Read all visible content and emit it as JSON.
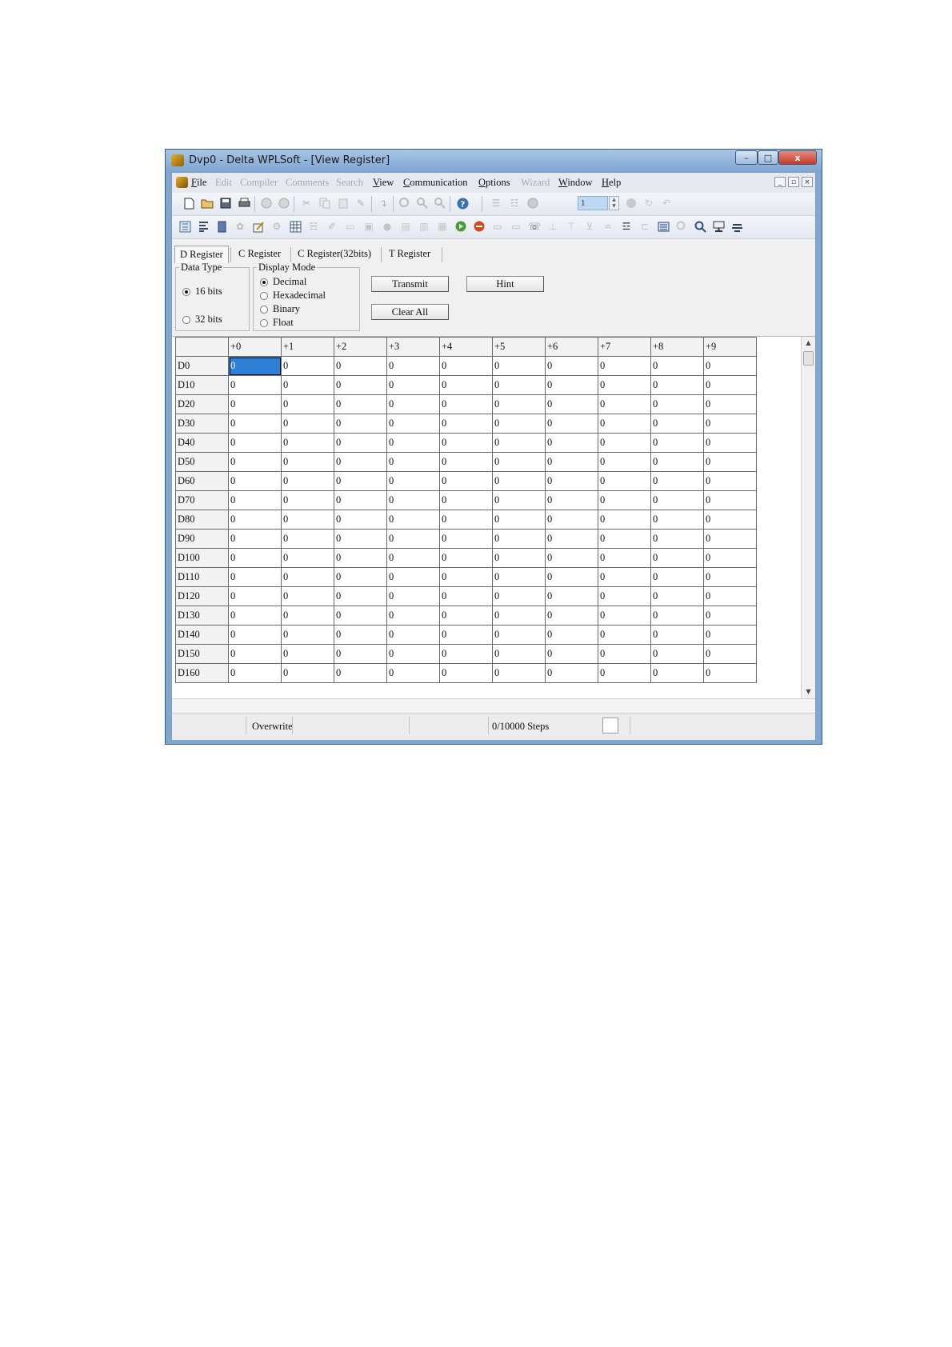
{
  "window": {
    "title": "Dvp0 - Delta WPLSoft - [View Register]",
    "min_glyph": "–",
    "max_glyph": "□",
    "close_glyph": "x"
  },
  "menu": [
    {
      "label": "File",
      "enabled": true
    },
    {
      "label": "Edit",
      "enabled": false
    },
    {
      "label": "Compiler",
      "enabled": false
    },
    {
      "label": "Comments",
      "enabled": false
    },
    {
      "label": "Search",
      "enabled": false
    },
    {
      "label": "View",
      "enabled": true
    },
    {
      "label": "Communication",
      "enabled": true
    },
    {
      "label": "Options",
      "enabled": true
    },
    {
      "label": "Wizard",
      "enabled": false
    },
    {
      "label": "Window",
      "enabled": true
    },
    {
      "label": "Help",
      "enabled": true
    }
  ],
  "mdi": {
    "min": "_",
    "restore": "▫",
    "close": "×"
  },
  "toolbar": {
    "step_value": "1"
  },
  "tabs": [
    "D Register",
    "C Register",
    "C Register(32bits)",
    "T Register"
  ],
  "data_type": {
    "legend": "Data Type",
    "options": [
      "16 bits",
      "32 bits"
    ],
    "selected": "16 bits"
  },
  "display_mode": {
    "legend": "Display Mode",
    "options": [
      "Decimal",
      "Hexadecimal",
      "Binary",
      "Float"
    ],
    "selected": "Decimal"
  },
  "buttons": {
    "transmit": "Transmit",
    "hint": "Hint",
    "clear_all": "Clear All"
  },
  "grid": {
    "columns": [
      "+0",
      "+1",
      "+2",
      "+3",
      "+4",
      "+5",
      "+6",
      "+7",
      "+8",
      "+9"
    ],
    "rows": [
      {
        "label": "D0",
        "values": [
          "0",
          "0",
          "0",
          "0",
          "0",
          "0",
          "0",
          "0",
          "0",
          "0"
        ]
      },
      {
        "label": "D10",
        "values": [
          "0",
          "0",
          "0",
          "0",
          "0",
          "0",
          "0",
          "0",
          "0",
          "0"
        ]
      },
      {
        "label": "D20",
        "values": [
          "0",
          "0",
          "0",
          "0",
          "0",
          "0",
          "0",
          "0",
          "0",
          "0"
        ]
      },
      {
        "label": "D30",
        "values": [
          "0",
          "0",
          "0",
          "0",
          "0",
          "0",
          "0",
          "0",
          "0",
          "0"
        ]
      },
      {
        "label": "D40",
        "values": [
          "0",
          "0",
          "0",
          "0",
          "0",
          "0",
          "0",
          "0",
          "0",
          "0"
        ]
      },
      {
        "label": "D50",
        "values": [
          "0",
          "0",
          "0",
          "0",
          "0",
          "0",
          "0",
          "0",
          "0",
          "0"
        ]
      },
      {
        "label": "D60",
        "values": [
          "0",
          "0",
          "0",
          "0",
          "0",
          "0",
          "0",
          "0",
          "0",
          "0"
        ]
      },
      {
        "label": "D70",
        "values": [
          "0",
          "0",
          "0",
          "0",
          "0",
          "0",
          "0",
          "0",
          "0",
          "0"
        ]
      },
      {
        "label": "D80",
        "values": [
          "0",
          "0",
          "0",
          "0",
          "0",
          "0",
          "0",
          "0",
          "0",
          "0"
        ]
      },
      {
        "label": "D90",
        "values": [
          "0",
          "0",
          "0",
          "0",
          "0",
          "0",
          "0",
          "0",
          "0",
          "0"
        ]
      },
      {
        "label": "D100",
        "values": [
          "0",
          "0",
          "0",
          "0",
          "0",
          "0",
          "0",
          "0",
          "0",
          "0"
        ]
      },
      {
        "label": "D110",
        "values": [
          "0",
          "0",
          "0",
          "0",
          "0",
          "0",
          "0",
          "0",
          "0",
          "0"
        ]
      },
      {
        "label": "D120",
        "values": [
          "0",
          "0",
          "0",
          "0",
          "0",
          "0",
          "0",
          "0",
          "0",
          "0"
        ]
      },
      {
        "label": "D130",
        "values": [
          "0",
          "0",
          "0",
          "0",
          "0",
          "0",
          "0",
          "0",
          "0",
          "0"
        ]
      },
      {
        "label": "D140",
        "values": [
          "0",
          "0",
          "0",
          "0",
          "0",
          "0",
          "0",
          "0",
          "0",
          "0"
        ]
      },
      {
        "label": "D150",
        "values": [
          "0",
          "0",
          "0",
          "0",
          "0",
          "0",
          "0",
          "0",
          "0",
          "0"
        ]
      },
      {
        "label": "D160",
        "values": [
          "0",
          "0",
          "0",
          "0",
          "0",
          "0",
          "0",
          "0",
          "0",
          "0"
        ]
      }
    ],
    "selected_cell": {
      "row": 0,
      "col": 0
    }
  },
  "scroll": {
    "up": "▲",
    "down": "▼"
  },
  "status": {
    "mode": "Overwrite",
    "steps": "0/10000 Steps"
  }
}
